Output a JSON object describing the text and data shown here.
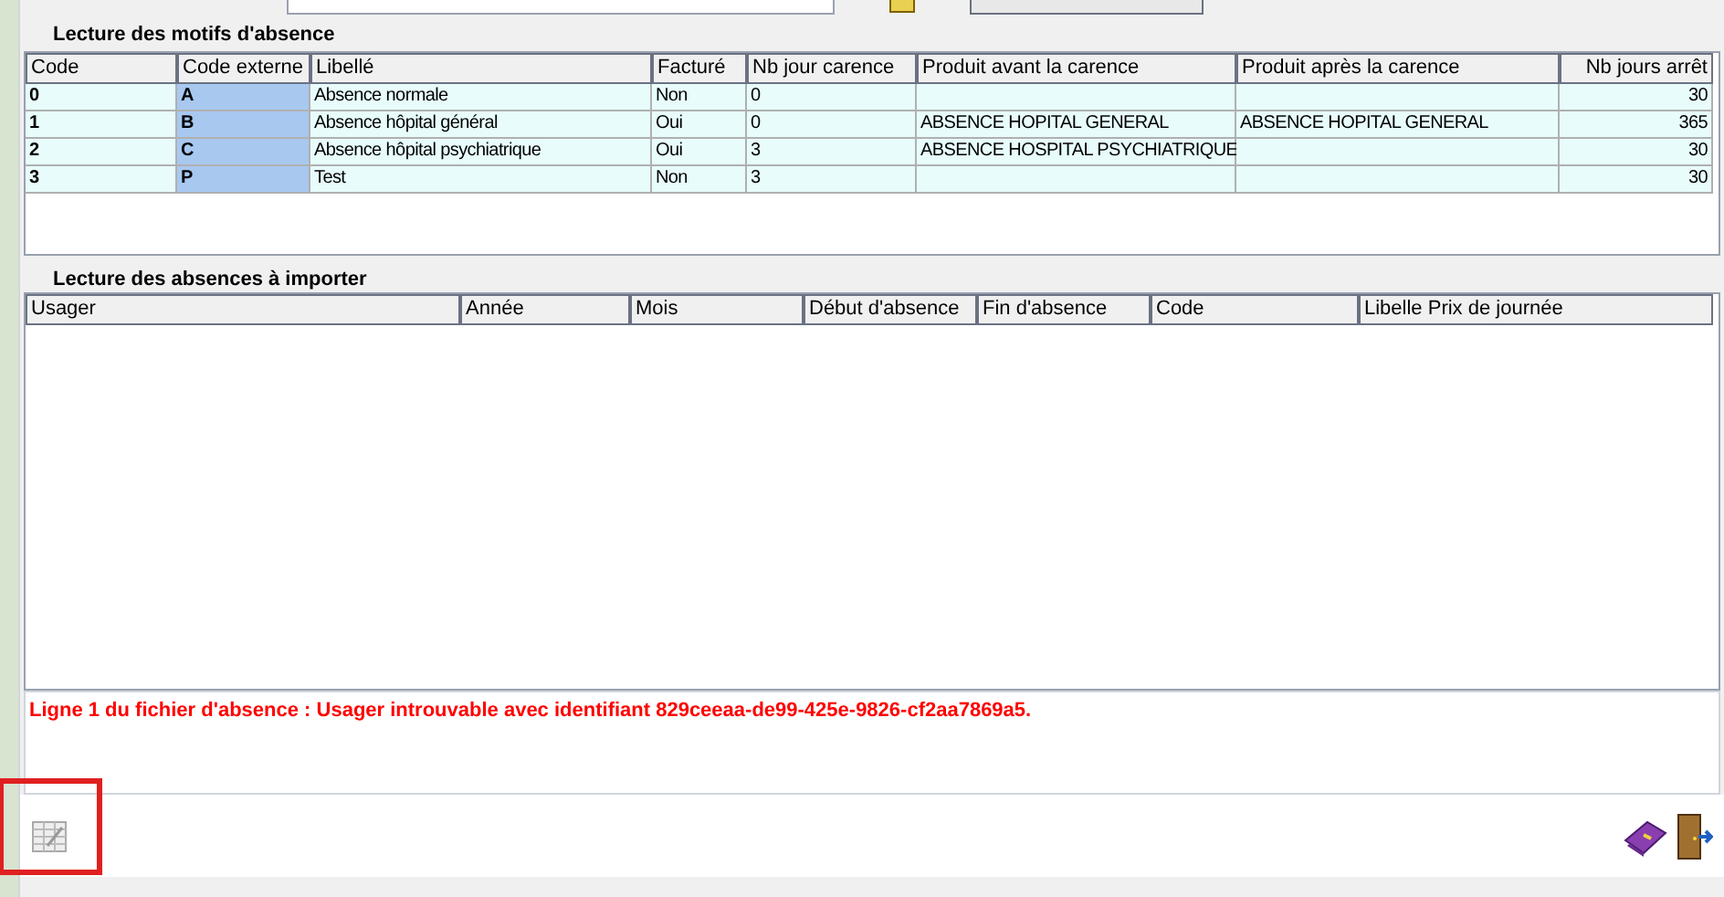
{
  "motifs": {
    "title": "Lecture des motifs d'absence",
    "columns": [
      {
        "label": "Code",
        "kind": "text"
      },
      {
        "label": "Code externe",
        "kind": "text"
      },
      {
        "label": "Libellé",
        "kind": "text"
      },
      {
        "label": "Facturé",
        "kind": "text"
      },
      {
        "label": "Nb jour carence",
        "kind": "text"
      },
      {
        "label": "Produit avant la carence",
        "kind": "text"
      },
      {
        "label": "Produit après la carence",
        "kind": "text"
      },
      {
        "label": "Nb jours arrêt",
        "kind": "number"
      }
    ],
    "rows": [
      [
        "0",
        "A",
        "Absence normale",
        "Non",
        "0",
        "",
        "",
        "30"
      ],
      [
        "1",
        "B",
        "Absence hôpital général",
        "Oui",
        "0",
        "ABSENCE HOPITAL GENERAL",
        "ABSENCE HOPITAL GENERAL",
        "365"
      ],
      [
        "2",
        "C",
        "Absence hôpital psychiatrique",
        "Oui",
        "3",
        "ABSENCE HOSPITAL PSYCHIATRIQUE",
        "",
        "30"
      ],
      [
        "3",
        "P",
        "Test",
        "Non",
        "3",
        "",
        "",
        "30"
      ]
    ]
  },
  "absences": {
    "title": "Lecture des absences à importer",
    "columns": [
      "Usager",
      "Année",
      "Mois",
      "Début d'absence",
      "Fin d'absence",
      "Code",
      "Libelle Prix de journée"
    ]
  },
  "message": "Ligne 1 du fichier d'absence : Usager introuvable avec identifiant 829ceeaa-de99-425e-9826-cf2aa7869a5."
}
